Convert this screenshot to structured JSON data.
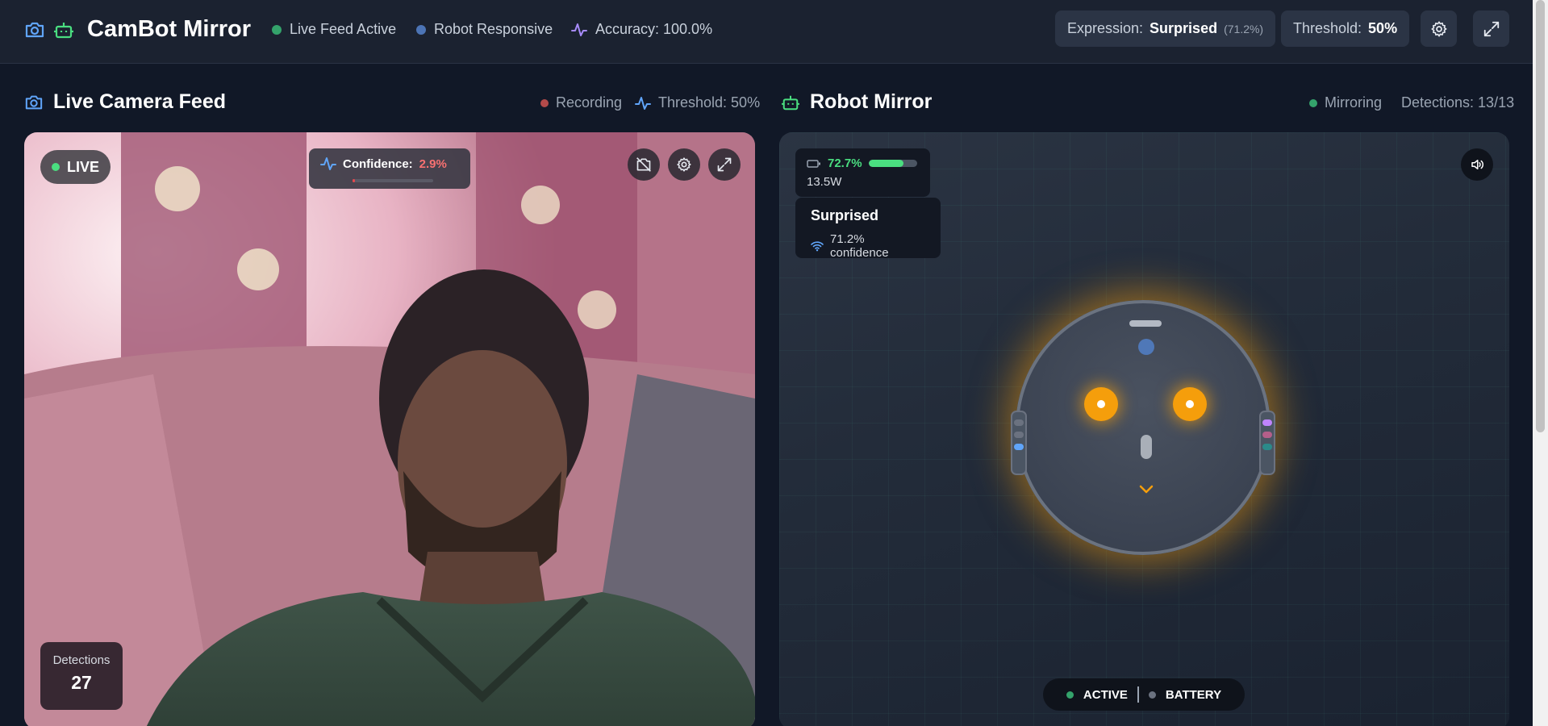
{
  "header": {
    "title": "CamBot Mirror",
    "status_items": [
      {
        "label": "Live Feed Active",
        "color": "#34a36b"
      },
      {
        "label": "Robot Responsive",
        "color": "#4c74b5"
      },
      {
        "label": "Accuracy: 100.0%",
        "color": "#a78bfa"
      }
    ],
    "expression": {
      "label": "Expression:",
      "value": "Surprised",
      "confidence": "(71.2%)"
    },
    "threshold": {
      "label": "Threshold:",
      "value": "50%"
    },
    "settings_icon": "gear-icon",
    "fullscreen_icon": "expand-icon"
  },
  "camera": {
    "title": "Live Camera Feed",
    "recording_label": "Recording",
    "threshold_label": "Threshold: 50%",
    "live_badge": "LIVE",
    "confidence_label": "Confidence:",
    "confidence_value": "2.9%",
    "confidence_level": 0.029,
    "detections_label": "Detections",
    "detections_value": "27"
  },
  "robot": {
    "title": "Robot Mirror",
    "mirroring_label": "Mirroring",
    "detections_label": "Detections: 13/13",
    "battery_percent": "72.7%",
    "battery_level": 0.727,
    "power": "13.5W",
    "expression": "Surprised",
    "expression_confidence": "71.2% confidence",
    "state_active": "ACTIVE",
    "state_battery": "BATTERY",
    "eye_color": "#f59e0b"
  }
}
